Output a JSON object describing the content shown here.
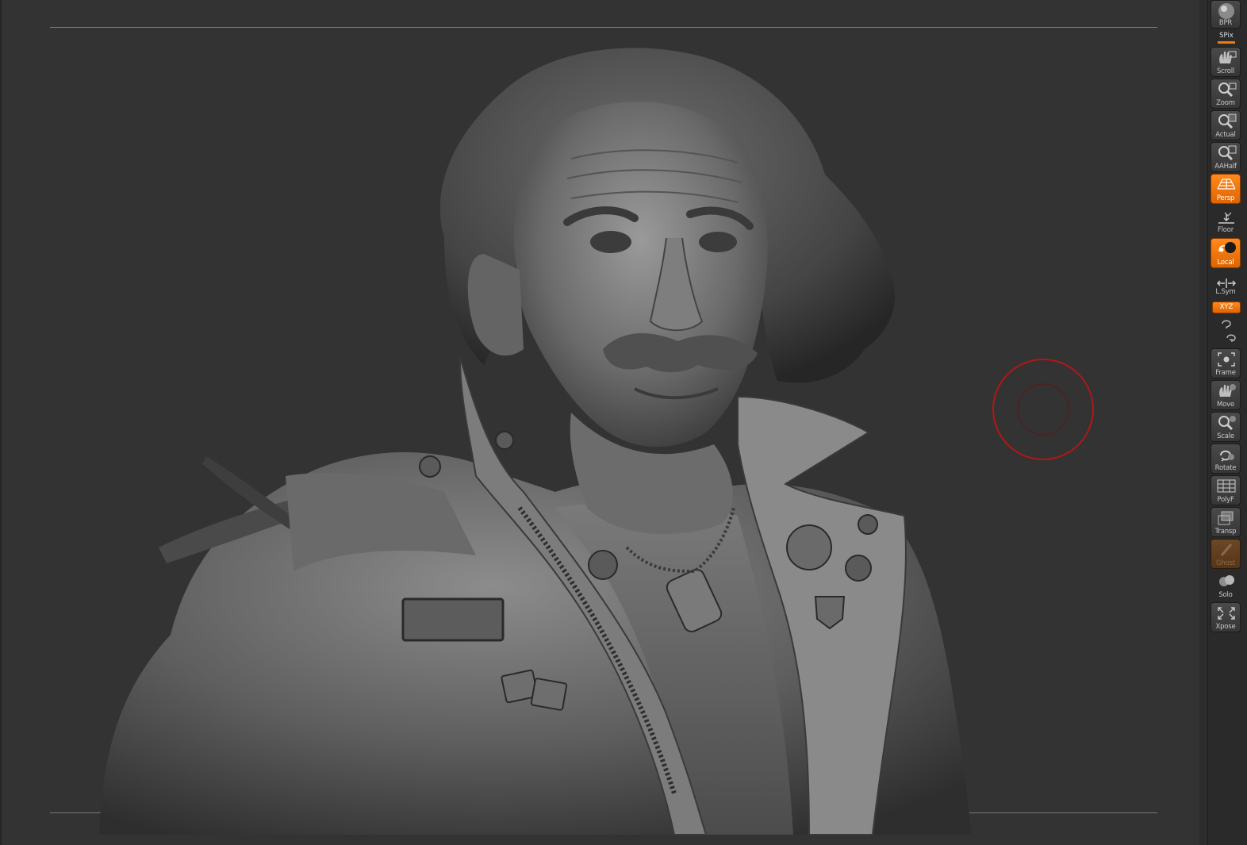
{
  "toolbar": {
    "bpr": "BPR",
    "spix": "SPix",
    "scroll": "Scroll",
    "zoom": "Zoom",
    "actual": "Actual",
    "aahalf": "AAHalf",
    "persp": "Persp",
    "floor": "Floor",
    "local": "Local",
    "lsym": "L.Sym",
    "xyz": "XYZ",
    "frame": "Frame",
    "move": "Move",
    "scale": "Scale",
    "rotate": "Rotate",
    "polyf": "PolyF",
    "transp": "Transp",
    "ghost": "Ghost",
    "solo": "Solo",
    "xpose": "Xpose"
  },
  "state": {
    "persp_on": true,
    "local_on": true,
    "xyz_on": true,
    "ghost_disabled": true
  },
  "colors": {
    "canvas_bg": "#333333",
    "accent_orange": "#f07810",
    "brush_red": "#b01818"
  },
  "viewport": {
    "model": "sculpted bust of an old man with wild hair and mustache wearing a leather jacket"
  }
}
